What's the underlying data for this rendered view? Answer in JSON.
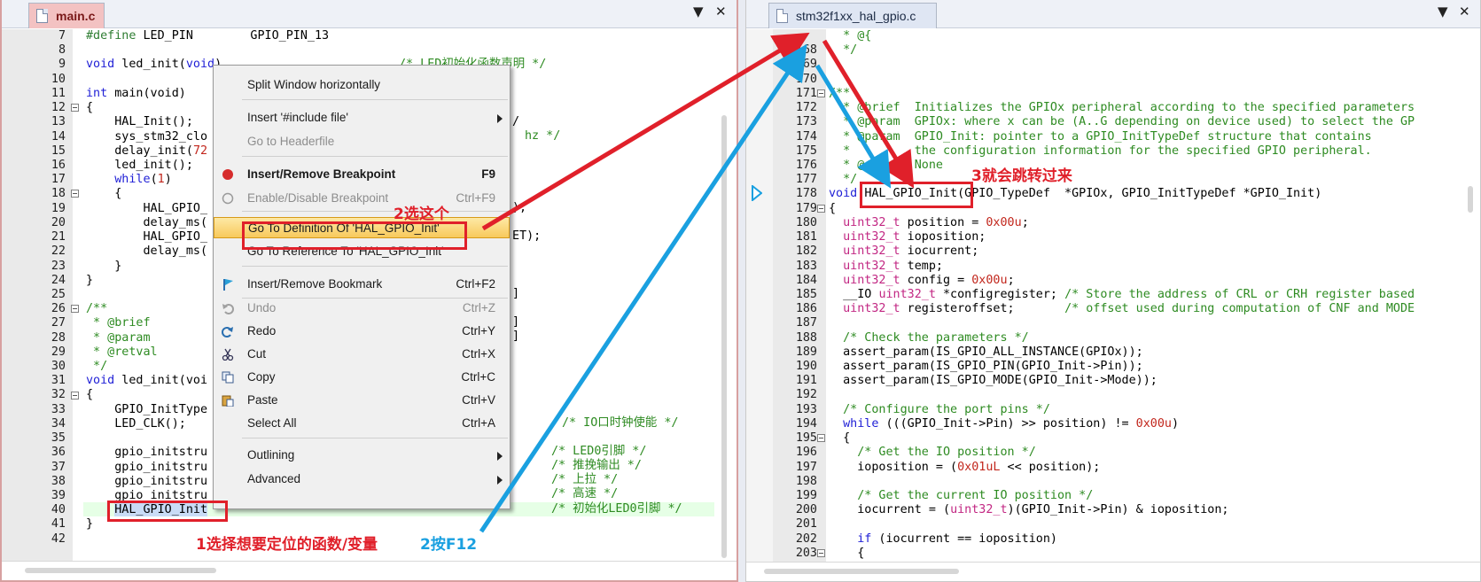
{
  "left_editor": {
    "tab_label": "main.c",
    "line_numbers": [
      "7",
      "8",
      "9",
      "10",
      "11",
      "12",
      "13",
      "14",
      "15",
      "16",
      "17",
      "18",
      "19",
      "20",
      "21",
      "22",
      "23",
      "24",
      "25",
      "26",
      "27",
      "28",
      "29",
      "30",
      "31",
      "32",
      "33",
      "34",
      "35",
      "36",
      "37",
      "38",
      "39",
      "40",
      "41",
      "42"
    ],
    "code": {
      "l7_kw": "#define",
      "l7_rest": " LED_PIN        GPIO_PIN_13",
      "l9_kw": "void",
      "l9_a": " led_init(",
      "l9_b": "void",
      "l9_c": ")",
      "l9_cm": "/* LED初始化函数声明 */",
      "l11_kw": "int",
      "l11_rest": " main(void)",
      "l12": "{",
      "l13": "    HAL_Init();",
      "l14": "    sys_stm32_clo",
      "l15_a": "    delay_init(",
      "l15_num": "72",
      "l16": "    led_init();",
      "l17_kw": "while",
      "l17_a": "(",
      "l17_num": "1",
      "l17_b": ")",
      "l18": "    {",
      "l19": "        HAL_GPIO_",
      "l20": "        delay_ms(",
      "l21": "        HAL_GPIO_",
      "l22": "        delay_ms(",
      "l23": "    }",
      "l24": "}",
      "l26": "/**",
      "l27": " * @brief",
      "l28": " * @param",
      "l29": " * @retval",
      "l30": " */",
      "l31_kw": "void",
      "l31_rest": " led_init(voi",
      "l32": "{",
      "l33": "    GPIO_InitType",
      "l34": "    LED_CLK();",
      "l36": "    gpio_initstru",
      "l37": "    gpio_initstru",
      "l38": "    gpio_initstru",
      "l39": "    gpio_initstru",
      "l40_sel": "HAL_GPIO_Init",
      "l41": "}",
      "r14": "/",
      "r14b": "hz */",
      "r19": ");",
      "r21": "ET);",
      "r24": "]",
      "r27": "]",
      "r28": "]",
      "c34": "/* IO口时钟使能 */",
      "c36": "/* LED0引脚 */",
      "c37": "/* 推挽输出 */",
      "c38": "/* 上拉 */",
      "c39": "/* 高速 */",
      "c40": "/* 初始化LED0引脚 */"
    }
  },
  "right_editor": {
    "tab_label": "stm32f1xx_hal_gpio.c",
    "line_numbers": [
      "",
      "168",
      "169",
      "170",
      "171",
      "172",
      "173",
      "174",
      "175",
      "176",
      "177",
      "178",
      "179",
      "180",
      "181",
      "182",
      "183",
      "184",
      "185",
      "186",
      "187",
      "188",
      "189",
      "190",
      "191",
      "192",
      "193",
      "194",
      "195",
      "196",
      "197",
      "198",
      "199",
      "200",
      "201",
      "202",
      "203"
    ],
    "code": {
      "l0": "  * @{",
      "l168": "  */",
      "l171": "/**",
      "l172": "  * @brief  Initializes the GPIOx peripheral according to the specified parameters",
      "l173": "  * @param  GPIOx: where x can be (A..G depending on device used) to select the GP",
      "l174": "  * @param  GPIO_Init: pointer to a GPIO_InitTypeDef structure that contains",
      "l175": "  *         the configuration information for the specified GPIO peripheral.",
      "l176": "  * @retval None",
      "l177": "  */",
      "l178_kw": "void",
      "l178_fn": "HAL_GPIO_Init",
      "l178_rest": "(GPIO_TypeDef  *GPIOx, GPIO_InitTypeDef *GPIO_Init)",
      "l179": "{",
      "l180_t": "uint32_t",
      "l180_a": " position = ",
      "l180_n": "0x00u",
      "l180_b": ";",
      "l181_t": "uint32_t",
      "l181_a": " ioposition;",
      "l182_t": "uint32_t",
      "l182_a": " iocurrent;",
      "l183_t": "uint32_t",
      "l183_a": " temp;",
      "l184_t": "uint32_t",
      "l184_a": " config = ",
      "l184_n": "0x00u",
      "l184_b": ";",
      "l185_a": "__IO ",
      "l185_t": "uint32_t",
      "l185_b": " *configregister; ",
      "l185_c": "/* Store the address of CRL or CRH register based",
      "l186_t": "uint32_t",
      "l186_a": " registeroffset;       ",
      "l186_c": "/* offset used during computation of CNF and MODE",
      "l188": "/* Check the parameters */",
      "l189": "assert_param(IS_GPIO_ALL_INSTANCE(GPIOx));",
      "l190": "assert_param(IS_GPIO_PIN(GPIO_Init->Pin));",
      "l191": "assert_param(IS_GPIO_MODE(GPIO_Init->Mode));",
      "l193": "/* Configure the port pins */",
      "l194_kw": "while",
      "l194_a": " (((GPIO_Init->Pin) >> position) != ",
      "l194_n": "0x00u",
      "l194_b": ")",
      "l195": "{",
      "l196": "/* Get the IO position */",
      "l197_a": "ioposition = (",
      "l197_n": "0x01uL",
      "l197_b": " << position);",
      "l199": "/* Get the current IO position */",
      "l200_a": "iocurrent = (",
      "l200_t": "uint32_t",
      "l200_b": ")(GPIO_Init->Pin) & ioposition;",
      "l202_kw": "if",
      "l202_a": " (iocurrent == ioposition)",
      "l203": "{"
    }
  },
  "context_menu": {
    "items": [
      {
        "label": "Split Window horizontally",
        "shortcut": ""
      },
      {
        "label": "Insert '#include file'",
        "shortcut": ""
      },
      {
        "label": "Go to Headerfile",
        "shortcut": ""
      },
      {
        "label": "Insert/Remove Breakpoint",
        "shortcut": "F9"
      },
      {
        "label": "Enable/Disable Breakpoint",
        "shortcut": "Ctrl+F9"
      },
      {
        "label": "Go To Definition Of 'HAL_GPIO_Init'",
        "shortcut": ""
      },
      {
        "label": "Go To Reference To 'HAL_GPIO_Init'",
        "shortcut": ""
      },
      {
        "label": "Insert/Remove Bookmark",
        "shortcut": "Ctrl+F2"
      },
      {
        "label": "Undo",
        "shortcut": "Ctrl+Z"
      },
      {
        "label": "Redo",
        "shortcut": "Ctrl+Y"
      },
      {
        "label": "Cut",
        "shortcut": "Ctrl+X"
      },
      {
        "label": "Copy",
        "shortcut": "Ctrl+C"
      },
      {
        "label": "Paste",
        "shortcut": "Ctrl+V"
      },
      {
        "label": "Select All",
        "shortcut": "Ctrl+A"
      },
      {
        "label": "Outlining",
        "shortcut": ""
      },
      {
        "label": "Advanced",
        "shortcut": ""
      }
    ]
  },
  "annotations": {
    "step1": "1选择想要定位的函数/变量",
    "step2a": "2选这个",
    "step2b": "2按F12",
    "step3": "3就会跳转过来"
  },
  "colors": {
    "annotation_red": "#e0202a",
    "annotation_blue": "#1aa0e0",
    "keyword": "#1f1fd6",
    "comment": "#2e8b22",
    "number": "#c2271d",
    "type": "#c22783"
  }
}
